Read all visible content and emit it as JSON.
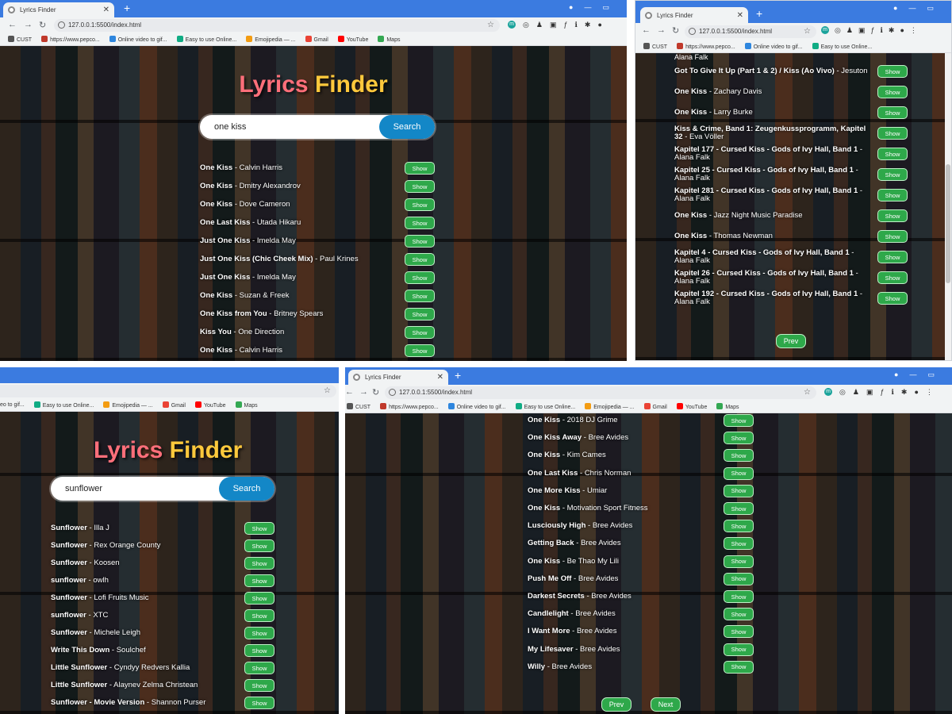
{
  "app_title": "Lyrics Finder",
  "title_word1": "Lyrics",
  "title_word2": "Finder",
  "tab_title": "Lyrics Finder",
  "new_tab_symbol": "+",
  "url": "127.0.0.1:5500/index.html",
  "bookmarks": [
    "CUST",
    "https://www.pepco...",
    "Online video to gif...",
    "Easy to use Online...",
    "Emojipedia — ...",
    "Gmail",
    "YouTube",
    "Maps"
  ],
  "bookmarks_short": [
    "CUST",
    "https://www.pepco...",
    "Online video to gif...",
    "Easy to use Online..."
  ],
  "bookmarks_left": [
    "eo to gif...",
    "Easy to use Online...",
    "Emojipedia — ...",
    "Gmail",
    "YouTube",
    "Maps"
  ],
  "search_button": "Search",
  "show_label": "Show",
  "prev_label": "Prev",
  "next_label": "Next",
  "colors": {
    "accent_blue": "#1387c7",
    "show_green": "#2ea84a",
    "title_pink": "#ff6f7a",
    "title_yellow": "#ffc93c",
    "chrome_blue": "#3b7be0"
  },
  "screens": {
    "s1": {
      "query": "one kiss",
      "results": [
        {
          "title": "One Kiss",
          "artist": "Calvin Harris"
        },
        {
          "title": "One Kiss",
          "artist": "Dmitry Alexandrov"
        },
        {
          "title": "One Kiss",
          "artist": "Dove Cameron"
        },
        {
          "title": "One Last Kiss",
          "artist": "Utada Hikaru"
        },
        {
          "title": "Just One Kiss",
          "artist": "Imelda May"
        },
        {
          "title": "Just One Kiss (Chic Cheek Mix)",
          "artist": "Paul Krines"
        },
        {
          "title": "Just One Kiss",
          "artist": "Imelda May"
        },
        {
          "title": "One Kiss",
          "artist": "Suzan & Freek"
        },
        {
          "title": "One Kiss from You",
          "artist": "Britney Spears"
        },
        {
          "title": "Kiss You",
          "artist": "One Direction"
        },
        {
          "title": "One Kiss",
          "artist": "Calvin Harris"
        }
      ]
    },
    "s2": {
      "partial_top": "Alana Falk",
      "results": [
        {
          "title": "Got To Give It Up (Part 1 & 2) / Kiss (Ao Vivo)",
          "artist": "Jesuton"
        },
        {
          "title": "One Kiss",
          "artist": "Zachary Davis"
        },
        {
          "title": "One Kiss",
          "artist": "Larry Burke"
        },
        {
          "title": "Kiss & Crime, Band 1: Zeugenkussprogramm, Kapitel 32",
          "artist": "Eva Völler"
        },
        {
          "title": "Kapitel 177 - Cursed Kiss - Gods of Ivy Hall, Band 1",
          "artist": "Alana Falk"
        },
        {
          "title": "Kapitel 25 - Cursed Kiss - Gods of Ivy Hall, Band 1",
          "artist": "Alana Falk"
        },
        {
          "title": "Kapitel 281 - Cursed Kiss - Gods of Ivy Hall, Band 1",
          "artist": "Alana Falk"
        },
        {
          "title": "One Kiss",
          "artist": "Jazz Night Music Paradise"
        },
        {
          "title": "One Kiss",
          "artist": "Thomas Newman"
        },
        {
          "title": "Kapitel 4 - Cursed Kiss - Gods of Ivy Hall, Band 1",
          "artist": "Alana Falk"
        },
        {
          "title": "Kapitel 26 - Cursed Kiss - Gods of Ivy Hall, Band 1",
          "artist": "Alana Falk"
        },
        {
          "title": "Kapitel 192 - Cursed Kiss - Gods of Ivy Hall, Band 1",
          "artist": "Alana Falk"
        }
      ]
    },
    "s3": {
      "query": "sunflower",
      "results": [
        {
          "title": "Sunflower",
          "artist": "Illa J"
        },
        {
          "title": "Sunflower",
          "artist": "Rex Orange County"
        },
        {
          "title": "Sunflower",
          "artist": "Koosen"
        },
        {
          "title": "sunflower",
          "artist": "owlh"
        },
        {
          "title": "Sunflower",
          "artist": "Lofi Fruits Music"
        },
        {
          "title": "sunflower",
          "artist": "XTC"
        },
        {
          "title": "Sunflower",
          "artist": "Michele Leigh"
        },
        {
          "title": "Write This Down",
          "artist": "Soulchef"
        },
        {
          "title": "Little Sunflower",
          "artist": "Cyndyy Redvers Kallia"
        },
        {
          "title": "Little Sunflower",
          "artist": "Alaynev Zelma Christean"
        },
        {
          "title": "Sunflower - Movie Version",
          "artist": "Shannon Purser"
        }
      ]
    },
    "s4": {
      "results": [
        {
          "title": "One Kiss",
          "artist": "2018 DJ Grime"
        },
        {
          "title": "One Kiss Away",
          "artist": "Bree Avides"
        },
        {
          "title": "One Kiss",
          "artist": "Kim Cames"
        },
        {
          "title": "One Last Kiss",
          "artist": "Chris Norman"
        },
        {
          "title": "One More Kiss",
          "artist": "Umiar"
        },
        {
          "title": "One Kiss",
          "artist": "Motivation Sport Fitness"
        },
        {
          "title": "Lusciously High",
          "artist": "Bree Avides"
        },
        {
          "title": "Getting Back",
          "artist": "Bree Avides"
        },
        {
          "title": "One Kiss",
          "artist": "Be Thao My Lili"
        },
        {
          "title": "Push Me Off",
          "artist": "Bree Avides"
        },
        {
          "title": "Darkest Secrets",
          "artist": "Bree Avides"
        },
        {
          "title": "Candlelight",
          "artist": "Bree Avides"
        },
        {
          "title": "I Want More",
          "artist": "Bree Avides"
        },
        {
          "title": "My Lifesaver",
          "artist": "Bree Avides"
        },
        {
          "title": "Willy",
          "artist": "Bree Avides"
        }
      ]
    }
  }
}
